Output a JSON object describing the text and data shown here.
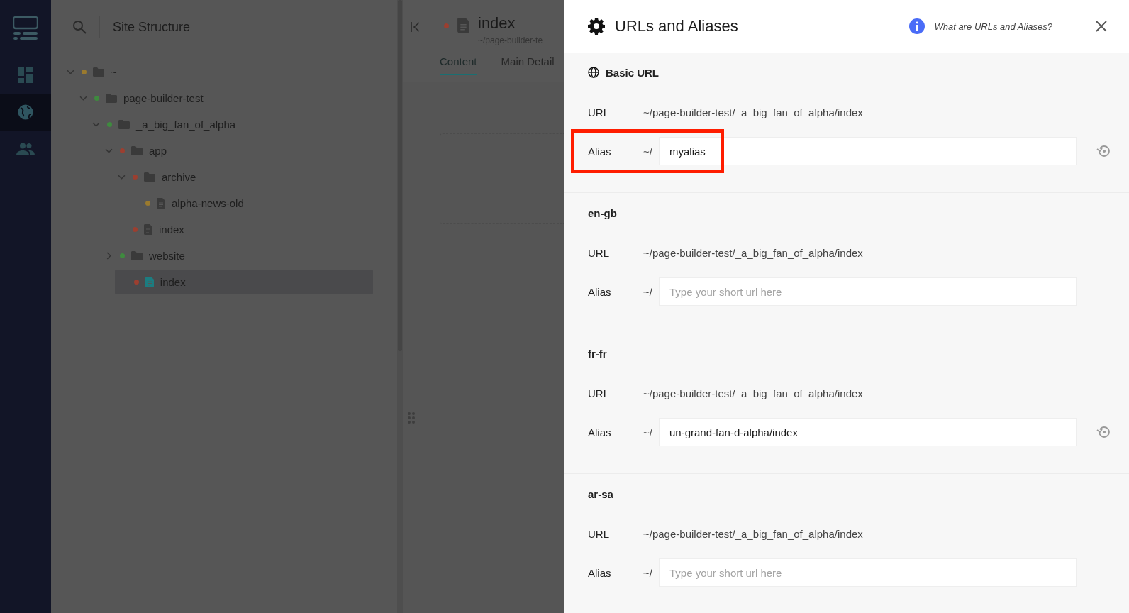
{
  "site_panel": {
    "title": "Site Structure",
    "tree": [
      {
        "label": "~",
        "kind": "folder",
        "expanded": true,
        "selected": false,
        "color": "#9a7a2e",
        "children": [
          {
            "label": "page-builder-test",
            "kind": "folder",
            "expanded": true,
            "selected": false,
            "color": "#3f8a3f",
            "children": [
              {
                "label": "_a_big_fan_of_alpha",
                "kind": "folder",
                "expanded": true,
                "selected": false,
                "color": "#3f8a3f",
                "children": [
                  {
                    "label": "app",
                    "kind": "folder",
                    "expanded": true,
                    "selected": false,
                    "color": "#9c3f30",
                    "children": [
                      {
                        "label": "archive",
                        "kind": "folder",
                        "expanded": true,
                        "selected": false,
                        "color": "#9c3f30",
                        "children": [
                          {
                            "label": "alpha-news-old",
                            "kind": "page",
                            "selected": false,
                            "color": "#9a7a2e"
                          }
                        ]
                      },
                      {
                        "label": "index",
                        "kind": "page",
                        "selected": false,
                        "color": "#9c3f30"
                      }
                    ]
                  },
                  {
                    "label": "website",
                    "kind": "folder",
                    "expanded": false,
                    "selected": false,
                    "color": "#3f8a3f"
                  },
                  {
                    "label": "index",
                    "kind": "page",
                    "selected": true,
                    "color": "#9c3f30"
                  }
                ]
              }
            ]
          }
        ]
      }
    ]
  },
  "page_panel": {
    "title": "index",
    "color": "#9c3f30",
    "path": "~/page-builder-te",
    "tabs": [
      {
        "label": "Content",
        "selected": true
      },
      {
        "label": "Main Detail",
        "selected": false
      }
    ]
  },
  "drawer": {
    "title": "URLs and Aliases",
    "help_link": "What are URLs and Aliases?",
    "sections": [
      {
        "title": "Basic URL",
        "kind": "basic",
        "url_label": "URL",
        "url": "~/page-builder-test/_a_big_fan_of_alpha/index",
        "alias_label": "Alias",
        "prefix": "~/",
        "alias": "myalias",
        "highlighted": true
      },
      {
        "title": "en-gb",
        "kind": "locale",
        "url_label": "URL",
        "url": "~/page-builder-test/_a_big_fan_of_alpha/index",
        "alias_label": "Alias",
        "prefix": "~/",
        "placeholder": "Type your short url here",
        "highlighted": false
      },
      {
        "title": "fr-fr",
        "kind": "locale",
        "url_label": "URL",
        "url": "~/page-builder-test/_a_big_fan_of_alpha/index",
        "alias_label": "Alias",
        "prefix": "~/",
        "alias": "un-grand-fan-d-alpha/index",
        "highlighted": false
      },
      {
        "title": "ar-sa",
        "kind": "locale",
        "url_label": "URL",
        "url": "~/page-builder-test/_a_big_fan_of_alpha/index",
        "alias_label": "Alias",
        "prefix": "~/",
        "placeholder": "Type your short url here",
        "highlighted": false
      }
    ]
  }
}
